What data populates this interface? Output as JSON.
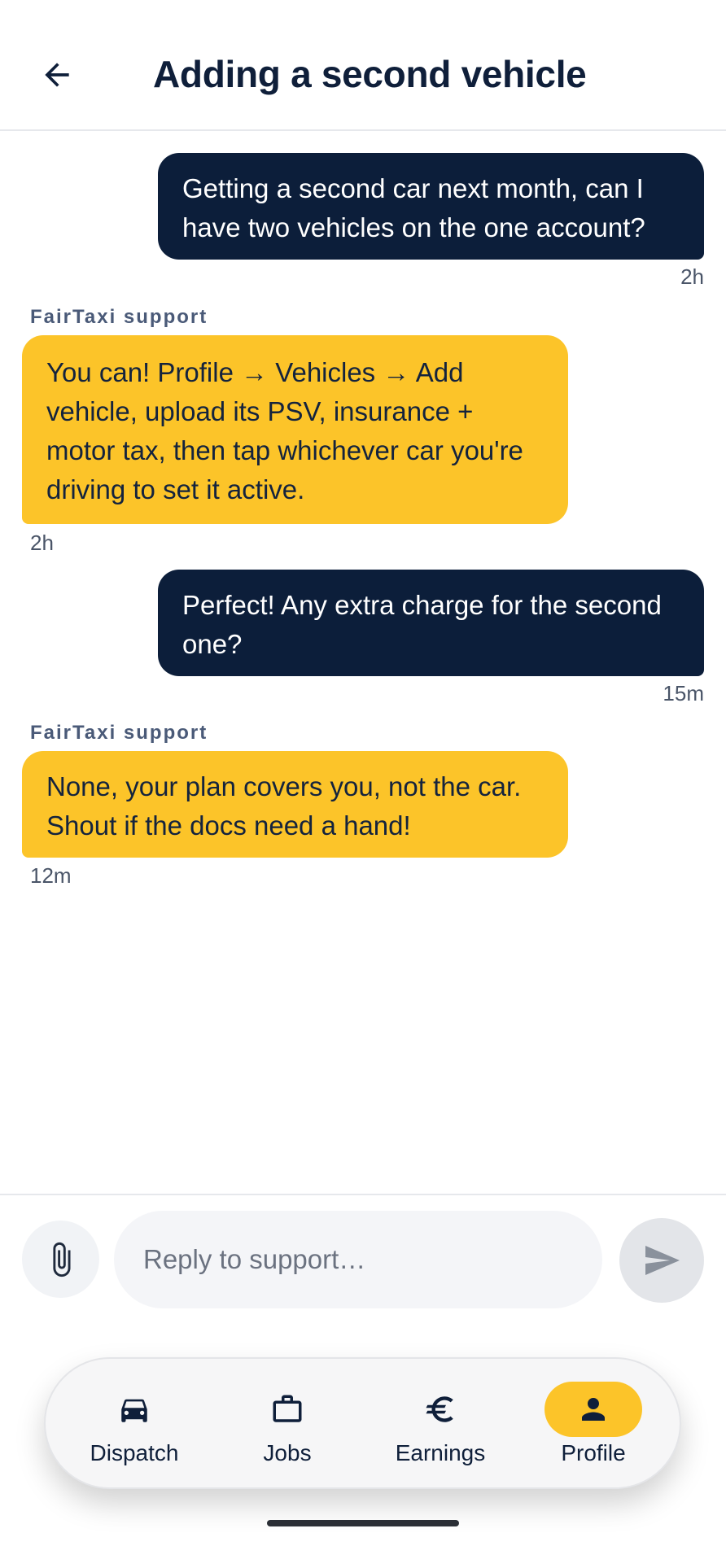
{
  "header": {
    "title": "Adding a second vehicle",
    "back_icon": "arrow-left-icon"
  },
  "messages": [
    {
      "direction": "outgoing",
      "text": "Getting a second car next month, can I have two vehicles on the one account?",
      "time": "2h"
    },
    {
      "direction": "incoming",
      "sender": "FairTaxi support",
      "text": "You can! Profile → Vehicles → Add vehicle, upload its PSV, insurance + motor tax, then tap whichever car you're driving to set it active.",
      "time": "2h"
    },
    {
      "direction": "outgoing",
      "text": "Perfect! Any extra charge for the second one?",
      "time": "15m"
    },
    {
      "direction": "incoming",
      "sender": "FairTaxi support",
      "text": "None, your plan covers you, not the car. Shout if the docs need a hand!",
      "time": "12m"
    }
  ],
  "composer": {
    "placeholder": "Reply to support…",
    "value": "",
    "attach_icon": "paperclip-icon",
    "send_icon": "send-icon"
  },
  "nav": {
    "items": [
      {
        "label": "Dispatch",
        "icon": "car-icon",
        "active": false
      },
      {
        "label": "Jobs",
        "icon": "briefcase-icon",
        "active": false
      },
      {
        "label": "Earnings",
        "icon": "euro-icon",
        "active": false
      },
      {
        "label": "Profile",
        "icon": "person-icon",
        "active": true
      }
    ]
  },
  "colors": {
    "outgoing_bubble": "#0c1e3a",
    "incoming_bubble": "#fcc429",
    "accent": "#fcc429",
    "text_dark": "#0f1f3a"
  }
}
